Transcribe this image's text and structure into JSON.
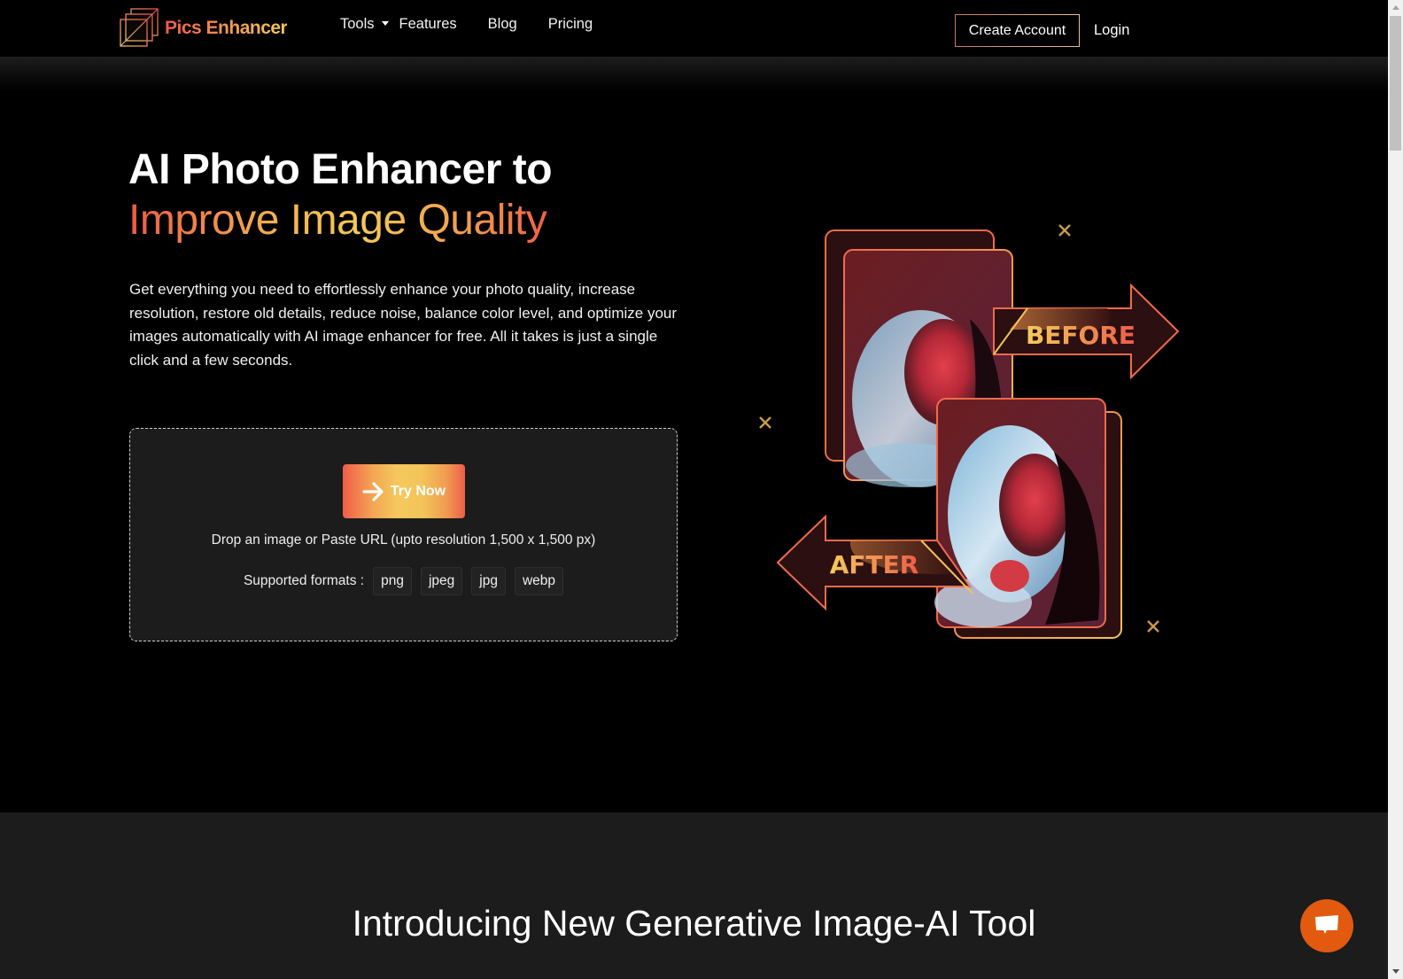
{
  "nav": {
    "brand": "Pics Enhancer",
    "links": [
      {
        "label": "Tools",
        "has_dropdown": true
      },
      {
        "label": "Features"
      },
      {
        "label": "Blog"
      },
      {
        "label": "Pricing"
      }
    ],
    "create_account": "Create Account",
    "login": "Login"
  },
  "hero": {
    "title_line1": "AI Photo Enhancer to",
    "title_line2": "Improve Image Quality",
    "description": "Get everything you need to effortlessly enhance your photo quality, increase resolution, restore old details, reduce noise, balance color level, and optimize your images automatically with AI image enhancer for free. All it takes is just a single click and a few seconds.",
    "upload": {
      "button_label": "Try Now",
      "drop_text": "Drop an image or Paste URL (upto resolution 1,500 x 1,500 px)",
      "formats_label": "Supported formats :",
      "formats": [
        "png",
        "jpeg",
        "jpg",
        "webp"
      ]
    },
    "illustration": {
      "before_label": "BEFORE",
      "after_label": "AFTER"
    }
  },
  "section2": {
    "title": "Introducing New Generative Image-AI Tool"
  },
  "colors": {
    "accent_red": "#f05a48",
    "accent_yellow": "#f4c95a",
    "chat_orange": "#e15a10",
    "panel_bg": "#1c1c1c"
  },
  "icons": {
    "logo": "layered-squares-logo",
    "try_now": "arrow-right-icon",
    "chat": "chat-bubble-icon",
    "dropdown": "caret-down-icon"
  }
}
